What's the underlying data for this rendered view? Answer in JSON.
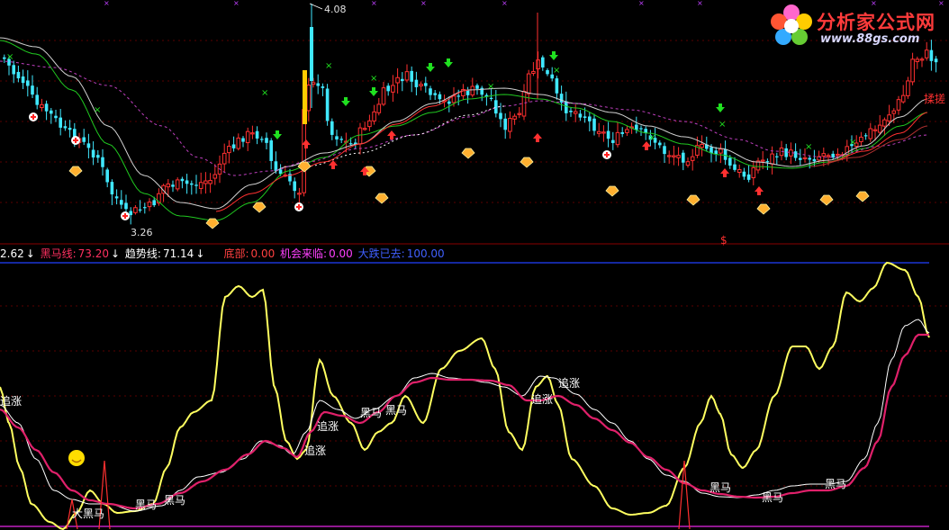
{
  "watermark": {
    "brand": "分析家公式网",
    "url": "www.88gs.com"
  },
  "price_high_label": "4.08",
  "price_low_label": "3.26",
  "right_edge_label": "揉搓",
  "legend": {
    "prefix": "2.62",
    "heima_label": "黑马线:",
    "heima_value": "73.20",
    "trend_label": "趋势线:",
    "trend_value": "71.14",
    "bottom_label": "底部:",
    "bottom_value": "0.00",
    "chance_label": "机会来临:",
    "chance_value": "0.00",
    "fall_label": "大跌已去:",
    "fall_value": "100.00"
  },
  "colors": {
    "up": "#ff3030",
    "down": "#40e8ff",
    "yellow": "#ffff60",
    "magenta": "#e0206a",
    "white": "#ffffff",
    "green_ma": "#20c820",
    "blue_line": "#2040ff",
    "pink_line": "#c020c0"
  },
  "chart_data": [
    {
      "type": "candlestick",
      "title": "",
      "y_labels": [
        "4.08",
        "3.26"
      ],
      "overlays": [
        "ma-white",
        "ma-red",
        "ma-green",
        "ma-magenta-dashed",
        "ma-white-dashed"
      ],
      "signals": [
        "green-arrow-down",
        "red-arrow-up",
        "green-x",
        "diamond-icon",
        "red-cross-circle"
      ]
    },
    {
      "type": "line",
      "title": "",
      "series": [
        {
          "name": "黑马线",
          "last": 73.2
        },
        {
          "name": "趋势线",
          "last": 71.14
        }
      ],
      "annotations": [
        "追涨",
        "追涨",
        "追涨",
        "追涨",
        "追涨",
        "黑马",
        "黑马",
        "黑马",
        "黑马",
        "黑马",
        "黑马",
        "黑马",
        "大黑马"
      ],
      "markers": {
        "heima": "黑马",
        "chase": "追涨",
        "big_heima": "大黑马"
      }
    }
  ]
}
